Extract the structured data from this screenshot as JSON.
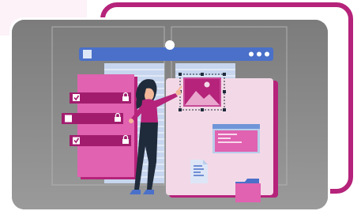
{
  "illustration": {
    "subject": "woman-arranging-ui-panels",
    "colors": {
      "magenta": "#B5237A",
      "pink": "#E062B0",
      "pink_light": "#F3D9E7",
      "gray_panel": "#8A8A8A",
      "blue_bar": "#4A70C9",
      "blue_light": "#B9CDEB",
      "dark_navy": "#1F2A3A",
      "white": "#FFFFFF"
    },
    "icons": [
      "browser-window-icon",
      "checkbox-checked-icon",
      "checkbox-empty-icon",
      "lock-icon",
      "image-placeholder-icon",
      "document-icon",
      "folder-icon"
    ]
  }
}
